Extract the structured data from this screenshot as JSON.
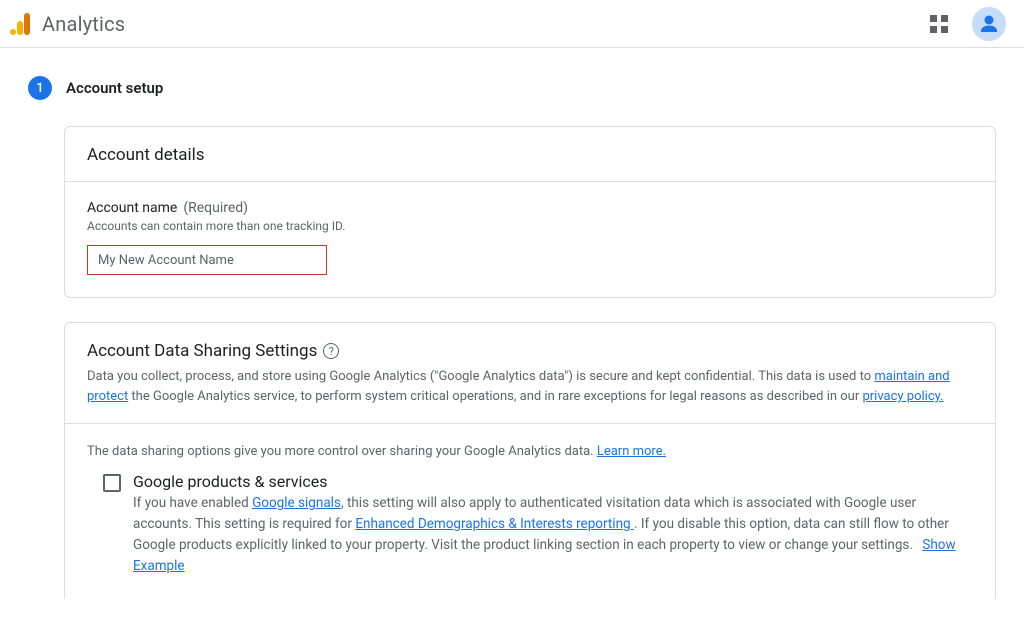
{
  "header": {
    "app_title": "Analytics"
  },
  "step": {
    "number": "1",
    "title": "Account setup"
  },
  "account_details": {
    "card_title": "Account details",
    "name_label": "Account name",
    "name_required": "(Required)",
    "name_hint": "Accounts can contain more than one tracking ID.",
    "name_value": "My New Account Name"
  },
  "data_sharing": {
    "title": "Account Data Sharing Settings",
    "desc_prefix": "Data you collect, process, and store using Google Analytics (\"Google Analytics data\") is secure and kept confidential. This data is used to ",
    "link_maintain": "maintain and protect",
    "desc_mid": " the Google Analytics service, to perform system critical operations, and in rare exceptions for legal reasons as described in our ",
    "link_privacy": "privacy policy.",
    "options_intro": "The data sharing options give you more control over sharing your Google Analytics data. ",
    "link_learn_more": "Learn more.",
    "option_google": {
      "title": "Google products & services",
      "body_prefix": "If you have enabled ",
      "link_signals": "Google signals",
      "body_mid1": ", this setting will also apply to authenticated visitation data which is associated with Google user accounts. This setting is required for ",
      "link_edi": "Enhanced Demographics & Interests reporting ",
      "body_mid2": ". If you disable this option, data can still flow to other Google products explicitly linked to your property. Visit the product linking section in each property to view or change your settings.  ",
      "show_example": "Show Example"
    }
  }
}
